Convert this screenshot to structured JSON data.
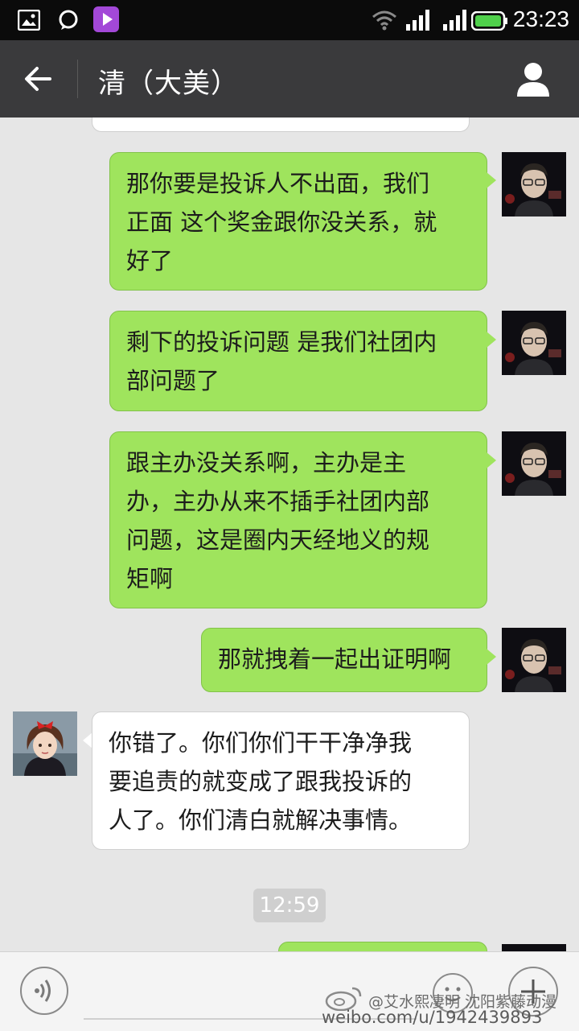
{
  "status_bar": {
    "time": "23:23",
    "icons": [
      "gallery-icon",
      "chat-notification-icon",
      "video-app-icon",
      "wifi-icon",
      "signal-icon",
      "signal-icon",
      "battery-icon"
    ]
  },
  "header": {
    "title": "清（大美）",
    "back_icon": "back-arrow-icon",
    "profile_icon": "person-icon"
  },
  "messages": [
    {
      "direction": "out",
      "lines": [
        "那你要是投诉人不出面，我们",
        "正面 这个奖金跟你没关系，就",
        "好了"
      ]
    },
    {
      "direction": "out",
      "lines": [
        "剩下的投诉问题 是我们社团内",
        "部问题了"
      ]
    },
    {
      "direction": "out",
      "lines": [
        "跟主办没关系啊，主办是主",
        "办，主办从来不插手社团内部",
        "问题，这是圈内天经地义的规",
        "矩啊"
      ]
    },
    {
      "direction": "out",
      "lines": [
        "那就拽着一起出证明啊"
      ]
    },
    {
      "direction": "in",
      "lines": [
        "你错了。你们你们干干净净我",
        "要追责的就变成了跟我投诉的",
        "人了。你们清白就解决事情。"
      ]
    }
  ],
  "timestamp": "12:59",
  "input_bar": {
    "voice_icon": "voice-icon",
    "emoji_icon": "emoji-icon",
    "plus_icon": "plus-icon"
  },
  "watermark": {
    "line1": "@艾水熙凄明 沈阳紫藤动漫",
    "line2": "weibo.com/u/1942439893"
  },
  "colors": {
    "outgoing_bubble": "#9fe45d",
    "incoming_bubble": "#ffffff",
    "header_bg": "#3a3a3c",
    "chat_bg": "#e6e6e6"
  }
}
